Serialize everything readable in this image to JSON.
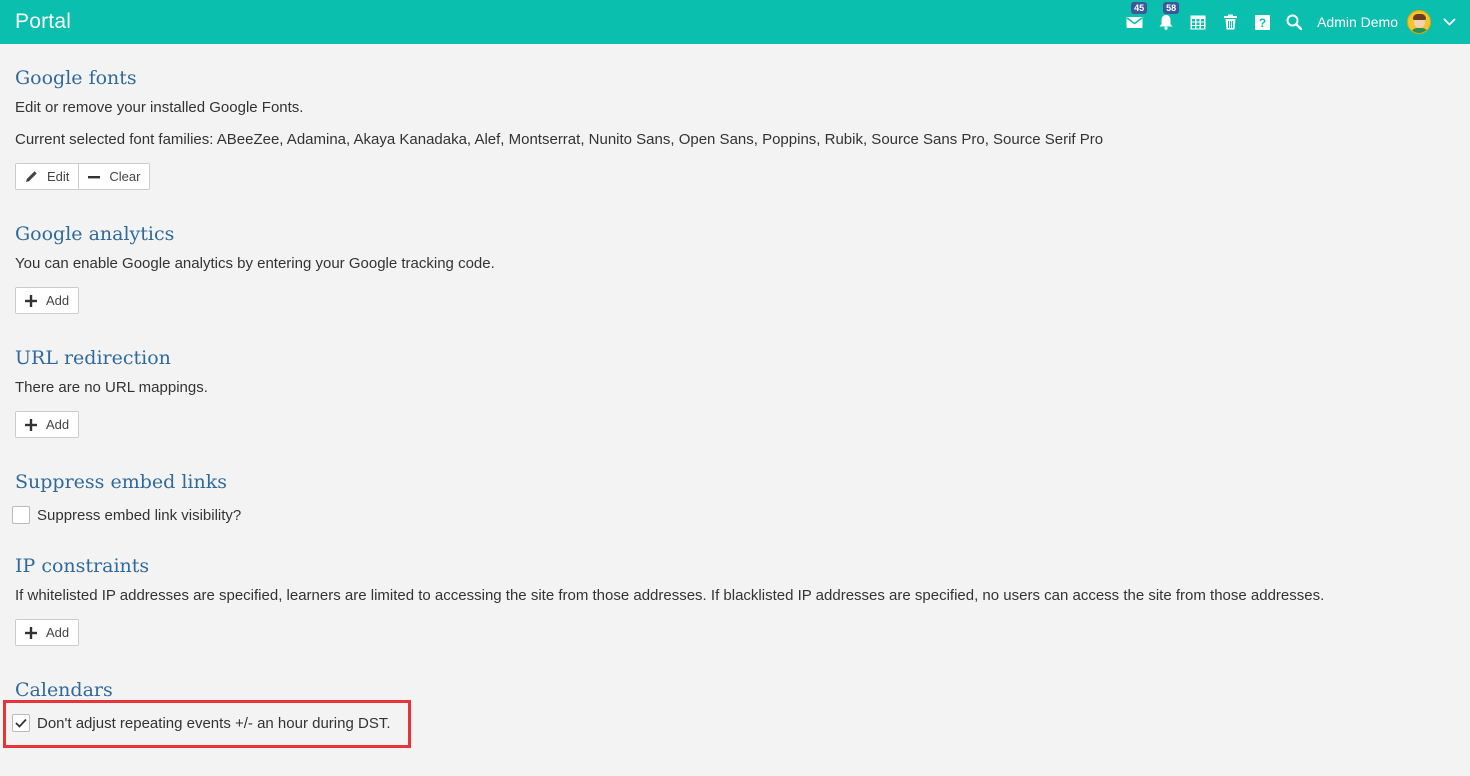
{
  "header": {
    "title": "Portal",
    "messages_badge": "45",
    "notifications_badge": "58",
    "user_name": "Admin Demo",
    "icons": [
      "envelope-icon",
      "bell-icon",
      "calendar-icon",
      "trash-icon",
      "help-icon",
      "search-icon",
      "chevron-down-icon"
    ]
  },
  "colors": {
    "topbar": "#0abfad",
    "heading": "#2f6a9a",
    "badge": "#3b5998",
    "highlight": "#e8333a"
  },
  "sections": {
    "fonts": {
      "title": "Google fonts",
      "desc": "Edit or remove your installed Google Fonts.",
      "current": "Current selected font families: ABeeZee, Adamina, Akaya Kanadaka, Alef, Montserrat, Nunito Sans, Open Sans, Poppins, Rubik, Source Sans Pro, Source Serif Pro",
      "edit_label": "Edit",
      "clear_label": "Clear"
    },
    "analytics": {
      "title": "Google analytics",
      "desc": "You can enable Google analytics by entering your Google tracking code.",
      "add_label": "Add"
    },
    "redirection": {
      "title": "URL redirection",
      "desc": "There are no URL mappings.",
      "add_label": "Add"
    },
    "embed": {
      "title": "Suppress embed links",
      "checkbox_label": "Suppress embed link visibility?",
      "checked": false
    },
    "ip": {
      "title": "IP constraints",
      "desc": "If whitelisted IP addresses are specified, learners are limited to accessing the site from those addresses. If blacklisted IP addresses are specified, no users can access the site from those addresses.",
      "add_label": "Add"
    },
    "calendars": {
      "title": "Calendars",
      "checkbox_label": "Don't adjust repeating events +/- an hour during DST.",
      "checked": true
    }
  }
}
